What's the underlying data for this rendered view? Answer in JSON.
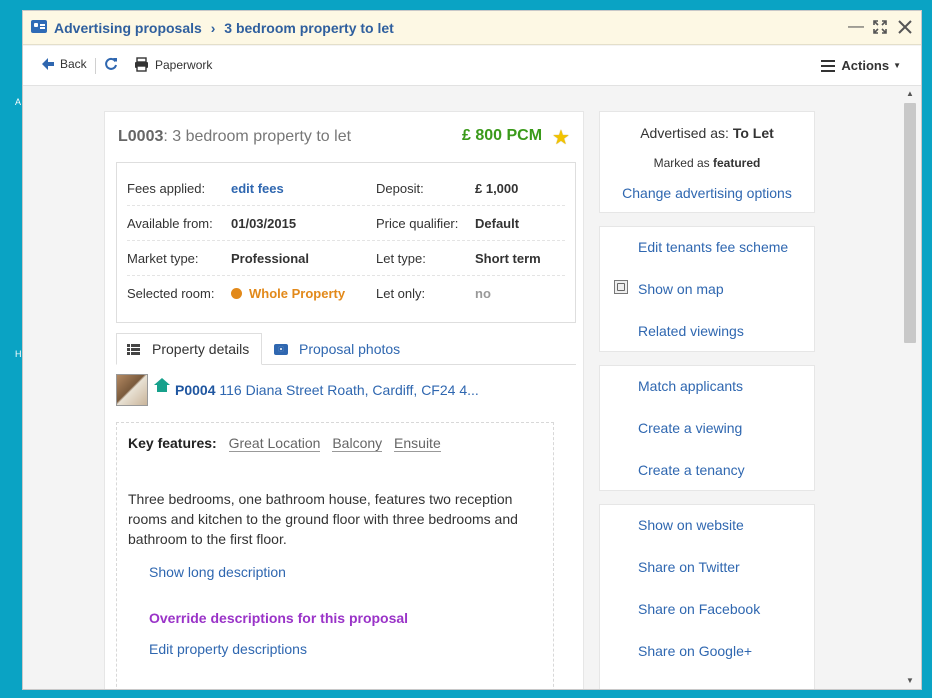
{
  "window": {
    "breadcrumb": [
      "Advertising proposals",
      "3 bedroom property to let"
    ],
    "breadcrumb_sep": "›"
  },
  "toolbar": {
    "back_label": "Back",
    "paperwork_label": "Paperwork",
    "actions_label": "Actions"
  },
  "proposal": {
    "ref": "L0003",
    "title": ": 3 bedroom property to let",
    "price": "£ 800 PCM"
  },
  "details": {
    "fees_label": "Fees applied:",
    "fees_value": "edit fees",
    "deposit_label": "Deposit:",
    "deposit_value": "£ 1,000",
    "available_label": "Available from:",
    "available_value": "01/03/2015",
    "qualifier_label": "Price qualifier:",
    "qualifier_value": "Default",
    "market_label": "Market type:",
    "market_value": "Professional",
    "lettype_label": "Let type:",
    "lettype_value": "Short term",
    "room_label": "Selected room:",
    "room_value": "Whole Property",
    "letonly_label": "Let only:",
    "letonly_value": "no"
  },
  "tabs": {
    "details": "Property details",
    "photos": "Proposal photos"
  },
  "property": {
    "ref": "P0004",
    "address": " 116 Diana Street Roath, Cardiff, CF24 4..."
  },
  "features": {
    "label": "Key features:",
    "tags": [
      "Great Location",
      "Balcony",
      "Ensuite"
    ],
    "description": "Three bedrooms, one bathroom house, features two reception rooms and kitchen to the ground floor with three bedrooms and bathroom to the first floor.",
    "long_desc_link": "Show long description",
    "override_link": "Override descriptions for this proposal",
    "edit_link": "Edit property descriptions"
  },
  "sidebar": {
    "advertised_prefix": "Advertised as:",
    "advertised_value": "To Let",
    "marked_prefix": "Marked as",
    "marked_value": "featured",
    "change_link": "Change advertising options",
    "group1": [
      "Edit tenants fee scheme",
      "Show on map",
      "Related viewings"
    ],
    "group2": [
      "Match applicants",
      "Create a viewing",
      "Create a tenancy"
    ],
    "group3": [
      "Show on website",
      "Share on Twitter",
      "Share on Facebook",
      "Share on Google+"
    ]
  },
  "background": {
    "left_letters": [
      "A",
      "H"
    ]
  },
  "colors": {
    "accent_blue": "#2f67b0",
    "price_green": "#3a9a1a",
    "room_orange": "#e2891a",
    "override_purple": "#9a33c8",
    "desktop": "#0aa3c4"
  }
}
